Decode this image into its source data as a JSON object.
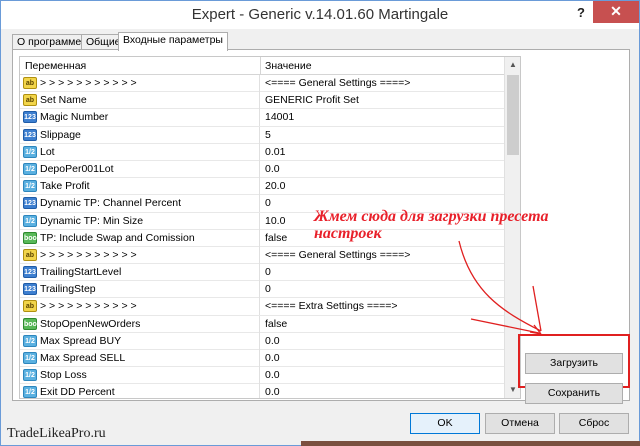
{
  "window": {
    "title": "Expert - Generic v.14.01.60 Martingale",
    "help_label": "?",
    "close_label": "✕"
  },
  "tabs": [
    {
      "label": "О программе"
    },
    {
      "label": "Общие"
    },
    {
      "label": "Входные параметры"
    }
  ],
  "grid": {
    "col_name": "Переменная",
    "col_value": "Значение",
    "rows": [
      {
        "icon": "ab",
        "name": "> > > > > > > > > > >",
        "value": "<==== General Settings ====>"
      },
      {
        "icon": "ab",
        "name": "Set Name",
        "value": "GENERIC Profit Set"
      },
      {
        "icon": "123",
        "name": "Magic Number",
        "value": "14001"
      },
      {
        "icon": "123",
        "name": "Slippage",
        "value": "5"
      },
      {
        "icon": "1/2",
        "name": "Lot",
        "value": "0.01"
      },
      {
        "icon": "1/2",
        "name": "DepoPer001Lot",
        "value": "0.0"
      },
      {
        "icon": "1/2",
        "name": "Take Profit",
        "value": "20.0"
      },
      {
        "icon": "123",
        "name": "Dynamic TP: Channel Percent",
        "value": "0"
      },
      {
        "icon": "1/2",
        "name": "Dynamic TP: Min Size",
        "value": "10.0"
      },
      {
        "icon": "bool",
        "name": "TP: Include Swap and Comission",
        "value": "false"
      },
      {
        "icon": "ab",
        "name": "> > > > > > > > > > >",
        "value": "<==== General Settings ====>"
      },
      {
        "icon": "123",
        "name": "TrailingStartLevel",
        "value": "0"
      },
      {
        "icon": "123",
        "name": "TrailingStep",
        "value": "0"
      },
      {
        "icon": "ab",
        "name": "> > > > > > > > > > >",
        "value": "<==== Extra Settings ====>"
      },
      {
        "icon": "bool",
        "name": "StopOpenNewOrders",
        "value": "false"
      },
      {
        "icon": "1/2",
        "name": "Max Spread BUY",
        "value": "0.0"
      },
      {
        "icon": "1/2",
        "name": "Max Spread SELL",
        "value": "0.0"
      },
      {
        "icon": "1/2",
        "name": "Stop Loss",
        "value": "0.0"
      },
      {
        "icon": "1/2",
        "name": "Exit DD Percent",
        "value": "0.0"
      }
    ]
  },
  "annotation": {
    "line1": "Жмем сюда для загрузки пресета",
    "line2": "настроек",
    "color": "#e8202a"
  },
  "buttons": {
    "load": "Загрузить",
    "save": "Сохранить",
    "ok": "OK",
    "cancel": "Отмена",
    "reset": "Сброс"
  },
  "watermark": "TradeLikeaPro.ru"
}
